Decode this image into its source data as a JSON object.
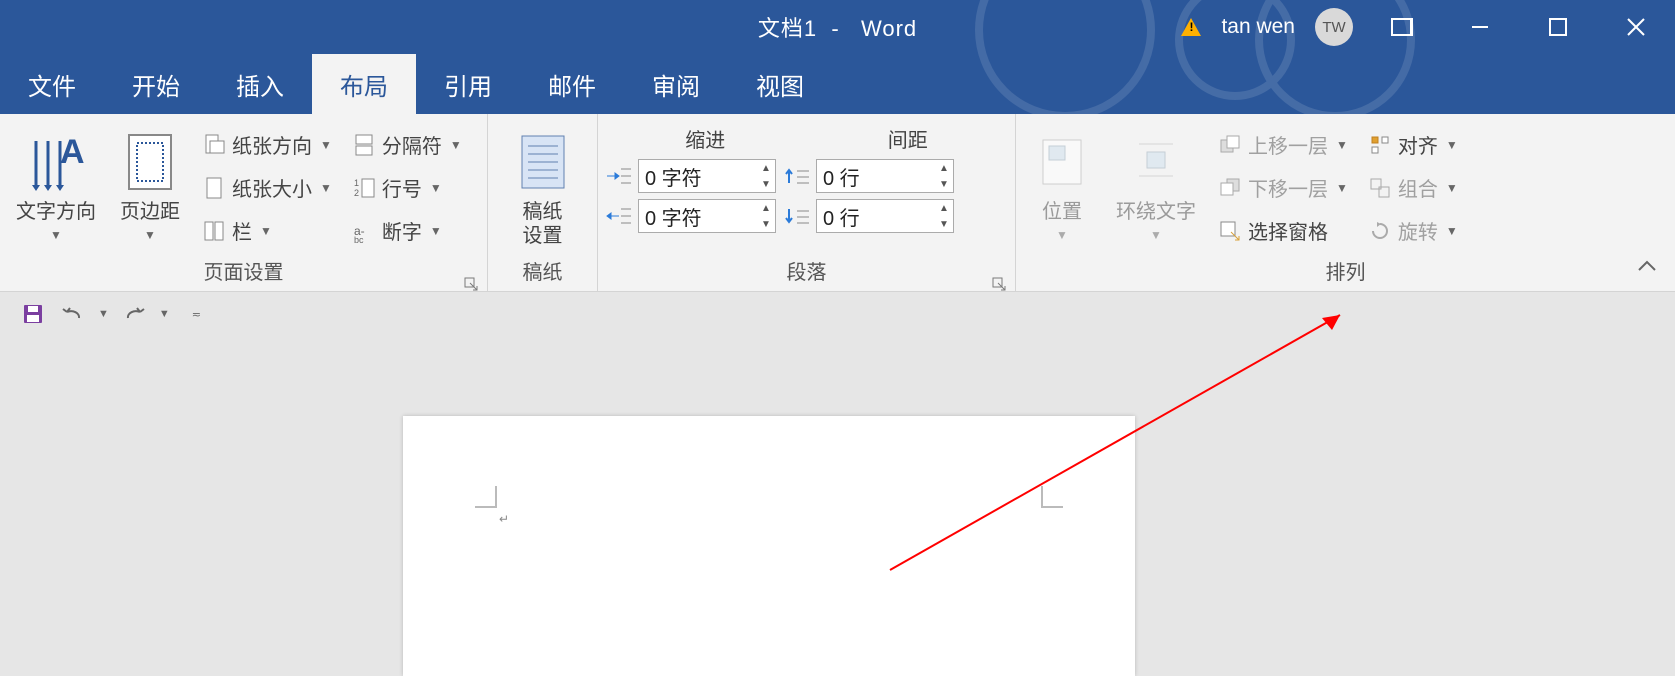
{
  "title": {
    "doc": "文档1",
    "sep": "-",
    "app": "Word"
  },
  "user": {
    "name": "tan wen",
    "initials": "TW"
  },
  "tabs": [
    "文件",
    "开始",
    "插入",
    "布局",
    "引用",
    "邮件",
    "审阅",
    "视图"
  ],
  "activeTab": 3,
  "ribbon": {
    "pageSetup": {
      "label": "页面设置",
      "textDirection": "文字方向",
      "margins": "页边距",
      "orientation": "纸张方向",
      "size": "纸张大小",
      "columns": "栏",
      "breaks": "分隔符",
      "lineNumbers": "行号",
      "hyphenation": "断字"
    },
    "manuscript": {
      "label": "稿纸",
      "button": "稿纸\n设置",
      "buttonL1": "稿纸",
      "buttonL2": "设置"
    },
    "paragraph": {
      "label": "段落",
      "indent": "缩进",
      "spacing": "间距",
      "leftVal": "0 字符",
      "rightVal": "0 字符",
      "beforeVal": "0 行",
      "afterVal": "0 行"
    },
    "arrange": {
      "label": "排列",
      "position": "位置",
      "wrap": "环绕文字",
      "bringForward": "上移一层",
      "sendBackward": "下移一层",
      "selectionPane": "选择窗格",
      "align": "对齐",
      "group": "组合",
      "rotate": "旋转"
    }
  }
}
